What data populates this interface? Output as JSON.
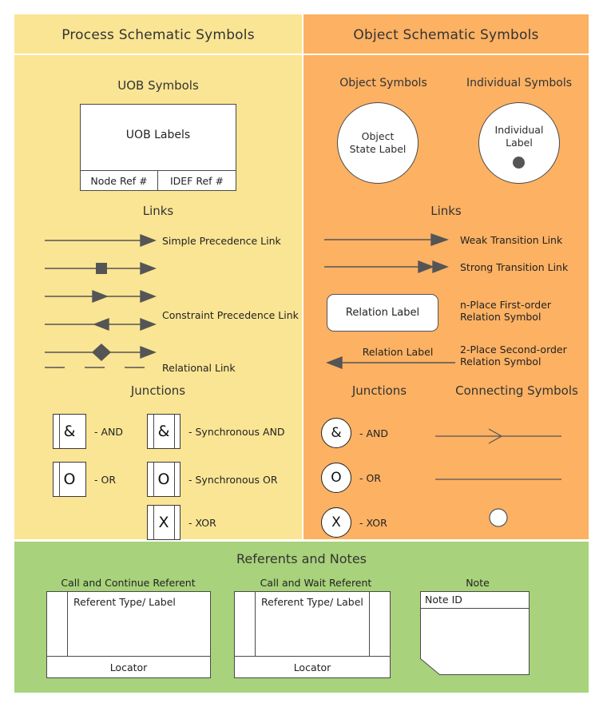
{
  "panels": {
    "process": {
      "title": "Process Schematic Symbols",
      "uob": {
        "section_title": "UOB Symbols",
        "main_label": "UOB Labels",
        "node_ref": "Node Ref #",
        "idef_ref": "IDEF Ref #"
      },
      "links": {
        "section_title": "Links",
        "items": [
          {
            "icon": "simple-precedence-arrow",
            "label": "Simple Precedence Link"
          },
          {
            "icon": "square-marker-arrow",
            "label": ""
          },
          {
            "icon": "double-arrow",
            "label": ""
          },
          {
            "icon": "opposed-arrow",
            "label": "Constraint Precedence Link"
          },
          {
            "icon": "diamond-marker-arrow",
            "label": ""
          },
          {
            "icon": "dashed-line",
            "label": "Relational Link"
          }
        ]
      },
      "junctions": {
        "section_title": "Junctions",
        "items": [
          {
            "glyph": "&",
            "label": "- AND",
            "sync": false
          },
          {
            "glyph": "&",
            "label": "- Synchronous AND",
            "sync": true
          },
          {
            "glyph": "O",
            "label": "- OR",
            "sync": false
          },
          {
            "glyph": "O",
            "label": "- Synchronous OR",
            "sync": true
          },
          {
            "glyph": "X",
            "label": "- XOR",
            "sync": true
          }
        ]
      }
    },
    "object": {
      "title": "Object Schematic Symbols",
      "object_symbols": {
        "section_title": "Object Symbols",
        "circle_label": "Object State Label"
      },
      "individual_symbols": {
        "section_title": "Individual Symbols",
        "circle_label": "Individual Label"
      },
      "links": {
        "section_title": "Links",
        "items": [
          {
            "icon": "weak-transition-arrow",
            "label": "Weak Transition Link"
          },
          {
            "icon": "strong-transition-arrow",
            "label": "Strong Transition Link"
          },
          {
            "icon": "rounded-relation-box",
            "box_label": "Relation Label",
            "label": "n-Place First-order Relation Symbol"
          },
          {
            "icon": "second-order-relation-line",
            "box_label": "Relation Label",
            "label": "2-Place Second-order Relation Symbol"
          }
        ]
      },
      "junctions": {
        "section_title": "Junctions",
        "items": [
          {
            "glyph": "&",
            "label": "- AND"
          },
          {
            "glyph": "O",
            "label": "- OR"
          },
          {
            "glyph": "X",
            "label": "- XOR"
          }
        ]
      },
      "connecting": {
        "section_title": "Connecting Symbols",
        "items": [
          {
            "icon": "open-arrow-line"
          },
          {
            "icon": "plain-line"
          },
          {
            "icon": "open-circle"
          }
        ]
      }
    },
    "referents": {
      "title": "Referents and Notes",
      "items": [
        {
          "caption": "Call and Continue Referent",
          "body_label": "Referent Type/ Label",
          "footer_label": "Locator"
        },
        {
          "caption": "Call and Wait Referent",
          "body_label": "Referent Type/ Label",
          "footer_label": "Locator"
        },
        {
          "caption": "Note",
          "id_label": "Note ID"
        }
      ]
    }
  },
  "colors": {
    "process_bg": "#fae594",
    "object_bg": "#fcb163",
    "referents_bg": "#a8d27b",
    "stroke": "#4a4a4a",
    "marker": "#555555"
  }
}
